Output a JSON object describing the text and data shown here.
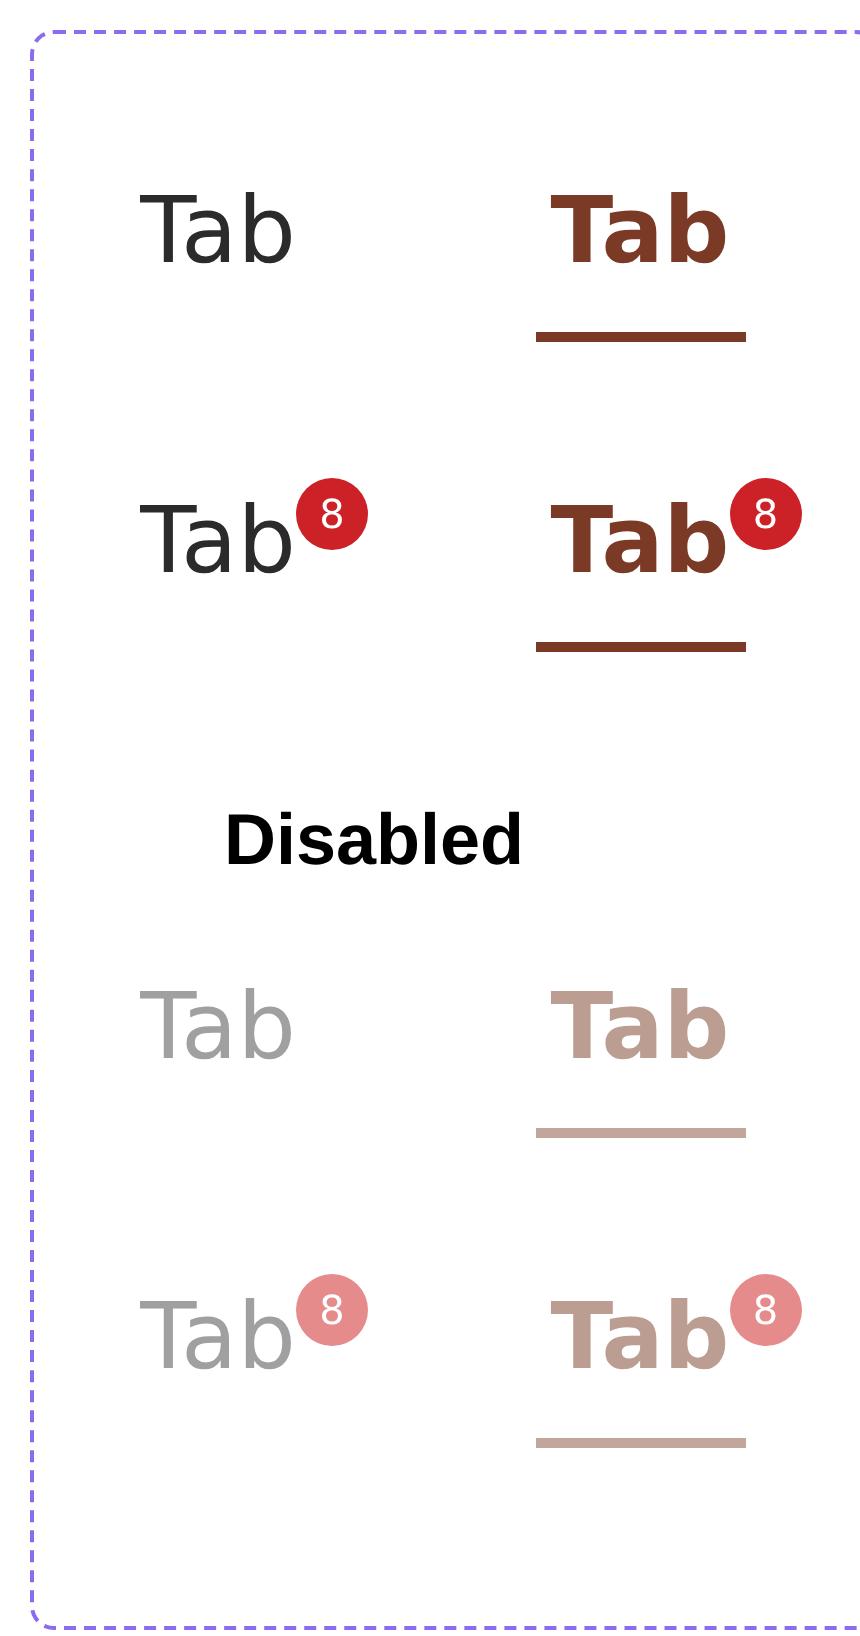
{
  "sections": [
    {
      "rows": [
        {
          "tabs": [
            {
              "label": "Tab",
              "selected": false,
              "disabled": false
            },
            {
              "label": "Tab",
              "selected": true,
              "disabled": false
            }
          ]
        },
        {
          "tabs": [
            {
              "label": "Tab",
              "selected": false,
              "disabled": false,
              "badge": "8"
            },
            {
              "label": "Tab",
              "selected": true,
              "disabled": false,
              "badge": "8"
            }
          ]
        }
      ]
    },
    {
      "title": "Disabled",
      "rows": [
        {
          "tabs": [
            {
              "label": "Tab",
              "selected": false,
              "disabled": true
            },
            {
              "label": "Tab",
              "selected": true,
              "disabled": true
            }
          ]
        },
        {
          "tabs": [
            {
              "label": "Tab",
              "selected": false,
              "disabled": true,
              "badge": "8"
            },
            {
              "label": "Tab",
              "selected": true,
              "disabled": true,
              "badge": "8"
            }
          ]
        }
      ]
    }
  ]
}
